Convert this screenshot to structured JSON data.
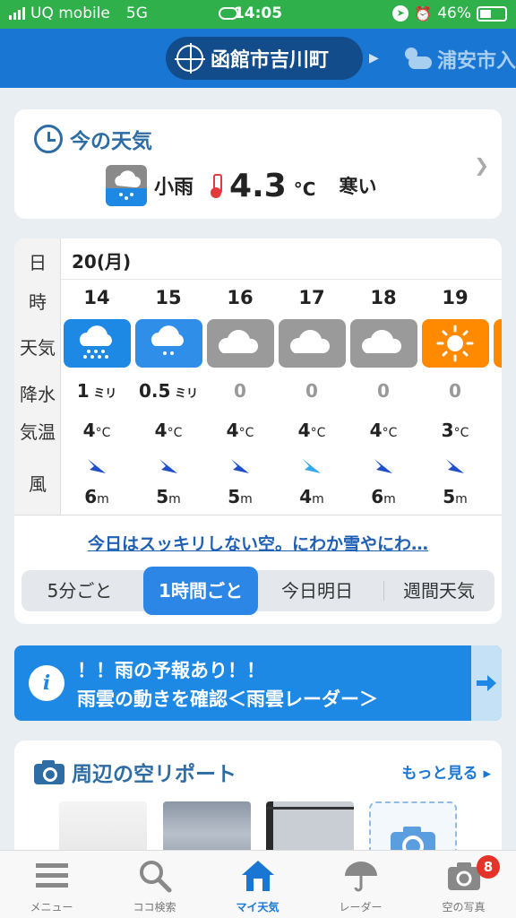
{
  "status_bar": {
    "carrier": "UQ mobile",
    "network": "5G",
    "time": "14:05",
    "battery": "46%",
    "battery_level": 0.46
  },
  "header": {
    "current_location": "函館市吉川町",
    "next_location": "浦安市入"
  },
  "now": {
    "title": "今の天気",
    "condition": "小雨",
    "temp": "4.3",
    "unit": "°C",
    "feel": "寒い"
  },
  "hourly": {
    "labels": {
      "day": "日",
      "hour": "時",
      "weather": "天気",
      "precip": "降水",
      "temp": "気温",
      "wind": "風"
    },
    "date": "20(月)",
    "precip_unit": "ミリ",
    "temp_unit": "°C",
    "wind_unit": "m",
    "hours": [
      {
        "hour": "14",
        "icon": "heavy-rain-icon",
        "precip": "1",
        "temp": "4",
        "wind": "6",
        "wind_dir": 315
      },
      {
        "hour": "15",
        "icon": "rain-icon",
        "precip": "0.5",
        "temp": "4",
        "wind": "5",
        "wind_dir": 315
      },
      {
        "hour": "16",
        "icon": "cloud-icon",
        "precip": "0",
        "temp": "4",
        "wind": "5",
        "wind_dir": 315
      },
      {
        "hour": "17",
        "icon": "cloud-icon",
        "precip": "0",
        "temp": "4",
        "wind": "4",
        "wind_dir": 315
      },
      {
        "hour": "18",
        "icon": "cloud-icon",
        "precip": "0",
        "temp": "4",
        "wind": "6",
        "wind_dir": 315
      },
      {
        "hour": "19",
        "icon": "sun-icon",
        "precip": "0",
        "temp": "3",
        "wind": "5",
        "wind_dir": 315
      }
    ],
    "comment": "今日はスッキリしない空。にわか雪やにわ…",
    "tabs": [
      "5分ごと",
      "1時間ごと",
      "今日明日",
      "週間天気"
    ],
    "active_tab": 1
  },
  "banner": {
    "line1": "！！雨の予報あり！！",
    "line2": "雨雲の動きを確認＜雨雲レーダー＞"
  },
  "sky_report": {
    "title": "周辺の空リポート",
    "more": "もっと見る"
  },
  "bottom_nav": {
    "items": [
      "メニュー",
      "ココ検索",
      "マイ天気",
      "レーダー",
      "空の写真"
    ],
    "active": 2,
    "badge": "8"
  },
  "colors": {
    "header": "#1976d2",
    "status": "#2fb04a",
    "rain_blue": "#1e88e5",
    "cloud_gray": "#9a9a9a",
    "sun_orange": "#ff8a00"
  }
}
